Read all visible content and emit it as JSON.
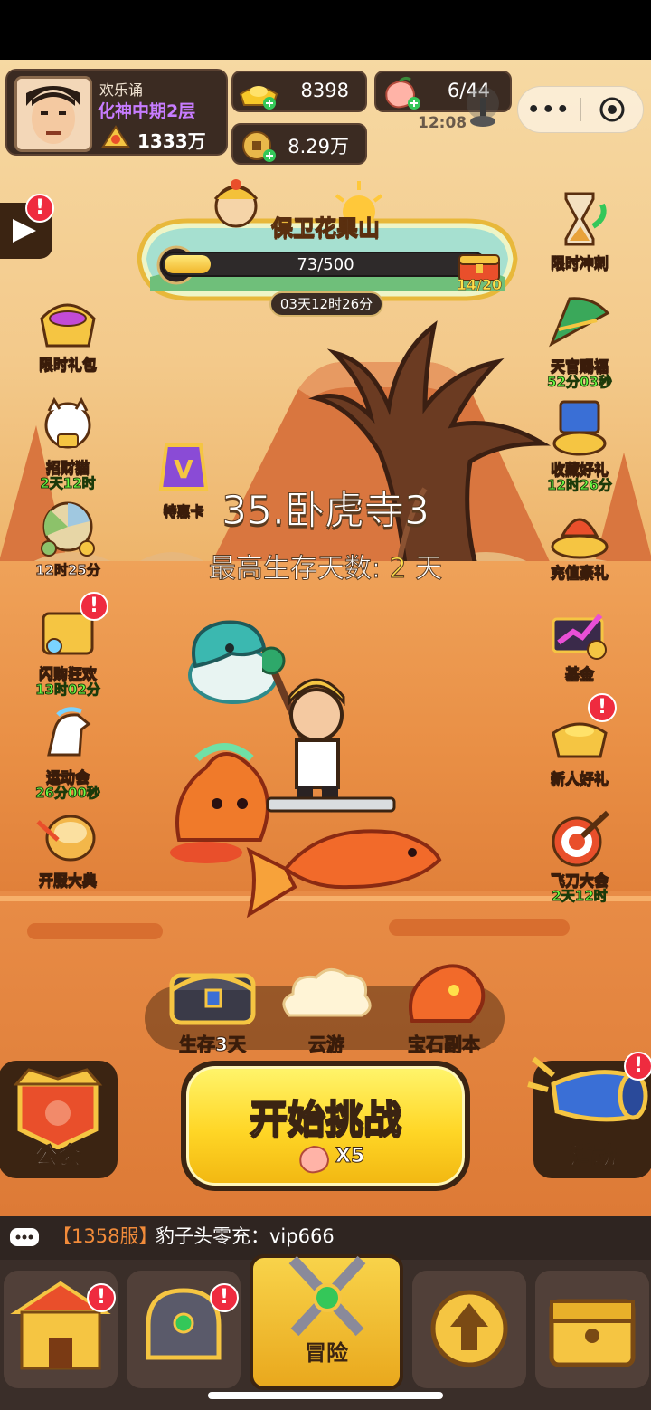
{
  "player": {
    "name": "欢乐诵",
    "rank": "化神中期2层",
    "power": "1333万"
  },
  "resources": {
    "gold": "8398",
    "coins": "8.29万",
    "stamina": "6/44",
    "stamina_timer": "12:08"
  },
  "event_banner": {
    "title": "保卫花果山",
    "progress_text": "73/500",
    "progress_ratio": 0.146,
    "chest_count": "14/20",
    "countdown": "03天12时26分"
  },
  "left_icons": [
    {
      "label": "限时礼包",
      "sub": ""
    },
    {
      "label": "招财猫",
      "sub": "2天12时"
    },
    {
      "label": "",
      "sub": "12时25分"
    },
    {
      "label": "闪购狂欢",
      "sub": "13时02分"
    },
    {
      "label": "运动会",
      "sub": "26分00秒"
    },
    {
      "label": "开服大典",
      "sub": ""
    }
  ],
  "vip_card": {
    "label": "特惠卡"
  },
  "right_icons": [
    {
      "label": "限时冲刺",
      "sub": ""
    },
    {
      "label": "天官赐福",
      "sub": "52分03秒"
    },
    {
      "label": "收藏好礼",
      "sub": "12时26分"
    },
    {
      "label": "充值豪礼",
      "sub": ""
    },
    {
      "label": "基金",
      "sub": ""
    },
    {
      "label": "新人好礼",
      "sub": ""
    },
    {
      "label": "飞刀大会",
      "sub": "2天12时"
    }
  ],
  "stage": {
    "title": "35.卧虎寺3",
    "survive_label": "最高生存天数:",
    "survive_days": "2",
    "survive_unit": "天"
  },
  "modes": [
    {
      "label": "生存3天"
    },
    {
      "label": "云游"
    },
    {
      "label": "宝石副本"
    }
  ],
  "start": {
    "label": "开始挑战",
    "cost": "X5"
  },
  "guild": {
    "label": "公会"
  },
  "activity": {
    "label": "活动"
  },
  "chat": {
    "server": "【1358服】",
    "message": "豹子头零充：vip666"
  },
  "nav": {
    "active_label": "冒险"
  },
  "badge_symbol": "!",
  "colors": {
    "accent_yellow": "#ffd626",
    "badge_red": "#ef2b3f",
    "timer_green": "#6bff45"
  }
}
